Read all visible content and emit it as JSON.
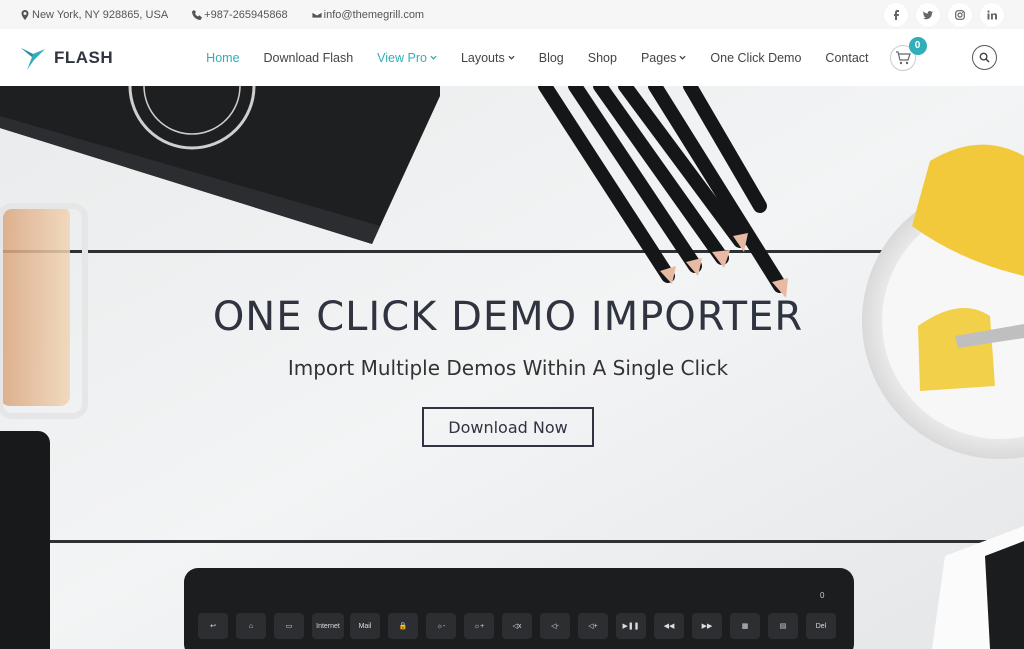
{
  "topbar": {
    "address": "New York, NY 928865, USA",
    "phone": "+987-265945868",
    "email": "info@themegrill.com",
    "social": [
      {
        "name": "facebook",
        "label": "f"
      },
      {
        "name": "twitter",
        "label": "t"
      },
      {
        "name": "instagram",
        "label": "ig"
      },
      {
        "name": "linkedin",
        "label": "in"
      }
    ]
  },
  "header": {
    "logo_text": "FLASH",
    "nav": [
      {
        "label": "Home",
        "active": true,
        "dropdown": false
      },
      {
        "label": "Download Flash",
        "active": false,
        "dropdown": false
      },
      {
        "label": "View Pro",
        "active": true,
        "dropdown": true
      },
      {
        "label": "Layouts",
        "active": false,
        "dropdown": true
      },
      {
        "label": "Blog",
        "active": false,
        "dropdown": false
      },
      {
        "label": "Shop",
        "active": false,
        "dropdown": false
      },
      {
        "label": "Pages",
        "active": false,
        "dropdown": true
      },
      {
        "label": "One Click Demo",
        "active": false,
        "dropdown": false
      },
      {
        "label": "Contact",
        "active": false,
        "dropdown": false
      }
    ],
    "cart_count": "0"
  },
  "hero": {
    "title": "ONE CLICK DEMO IMPORTER",
    "subtitle": "Import Multiple Demos Within A Single Click",
    "button_label": "Download Now"
  },
  "keyboard": {
    "keys": [
      "Internet",
      "Mail",
      "Del"
    ],
    "status_label": "0"
  },
  "colors": {
    "accent": "#30afb8",
    "dark": "#2f3440"
  }
}
